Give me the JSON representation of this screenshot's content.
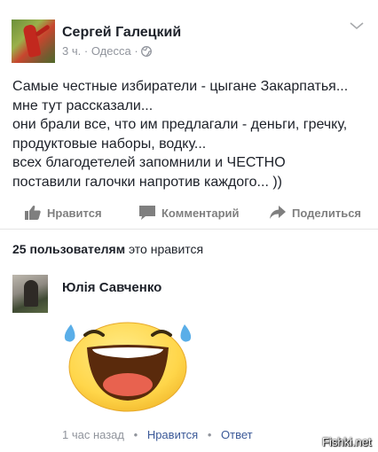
{
  "post": {
    "author": "Сергей Галецкий",
    "time": "3 ч.",
    "location": "Одесса",
    "separator": "·",
    "text_lines": [
      "Самые честные избиратели - цыгане Закарпатья...",
      "мне тут рассказали...",
      "они брали все, что им предлагали - деньги, гречку,",
      "продуктовые наборы, водку...",
      "всех благодетелей запомнили и ЧЕСТНО",
      "поставили галочки напротив каждого... ))"
    ]
  },
  "actions": {
    "like": "Нравится",
    "comment": "Комментарий",
    "share": "Поделиться"
  },
  "likes_summary": {
    "count_text": "25 пользователям",
    "suffix": "это нравится"
  },
  "comment": {
    "author": "Юлія Савченко",
    "time": "1 час назад",
    "like_label": "Нравится",
    "reply_label": "Ответ",
    "separator": "•"
  },
  "watermark": "Fishki.net",
  "icons": {
    "chevron": "chevron-down-icon",
    "globe": "globe-icon",
    "like": "thumbs-up-icon",
    "comment": "comment-bubble-icon",
    "share": "share-arrow-icon"
  },
  "colors": {
    "text": "#1d2129",
    "meta": "#90949c",
    "action": "#7f7f7f",
    "link": "#3b5998"
  }
}
